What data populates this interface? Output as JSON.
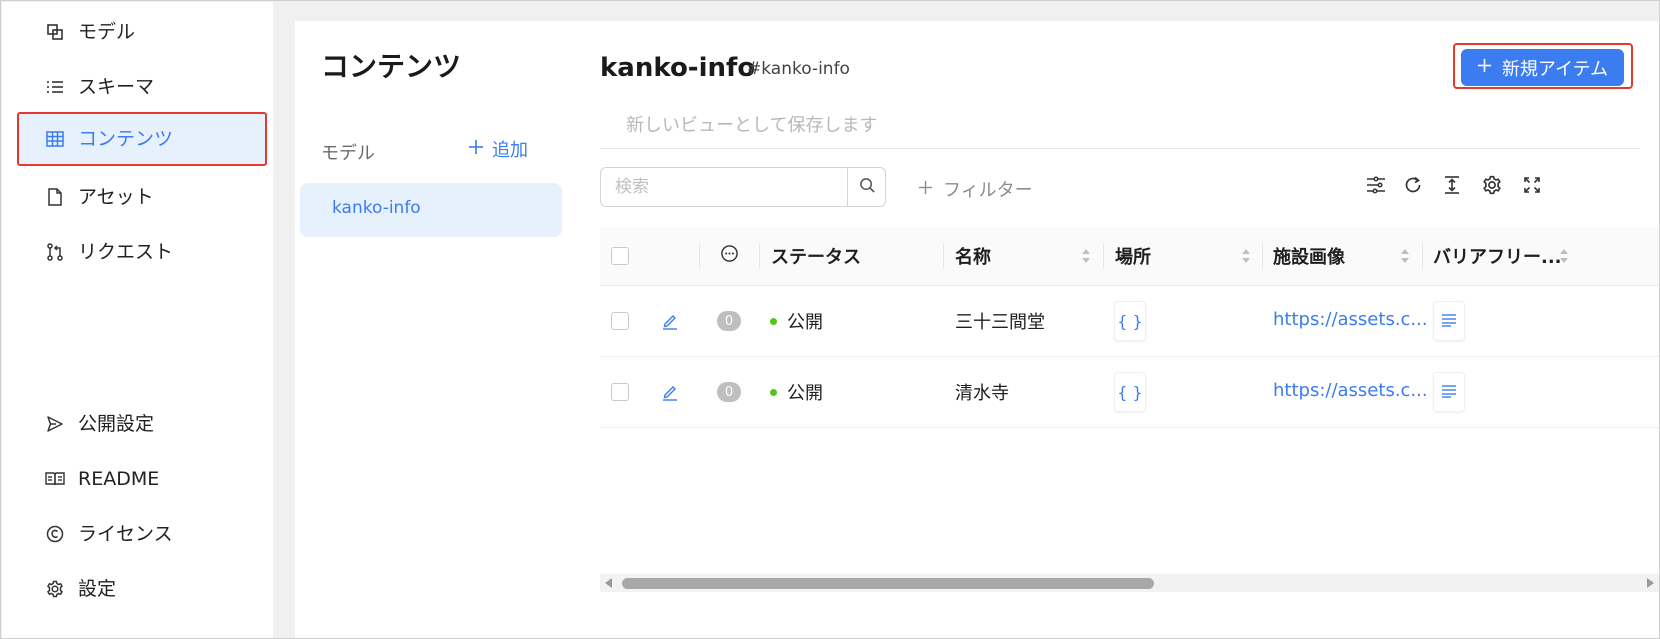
{
  "sidebar": {
    "items": [
      {
        "label": "モデル",
        "icon": "model-icon"
      },
      {
        "label": "スキーマ",
        "icon": "list-icon"
      },
      {
        "label": "コンテンツ",
        "icon": "table-icon",
        "active": true
      },
      {
        "label": "アセット",
        "icon": "file-icon"
      },
      {
        "label": "リクエスト",
        "icon": "pull-request-icon"
      }
    ],
    "bottom_items": [
      {
        "label": "公開設定",
        "icon": "send-icon"
      },
      {
        "label": "README",
        "icon": "book-icon"
      },
      {
        "label": "ライセンス",
        "icon": "copyright-icon"
      },
      {
        "label": "設定",
        "icon": "gear-icon"
      }
    ]
  },
  "models_panel": {
    "title": "コンテンツ",
    "subtitle": "モデル",
    "add_label": "追加",
    "items": [
      {
        "label": "kanko-info",
        "selected": true
      }
    ]
  },
  "main": {
    "title": "kanko-info",
    "key": "#kanko-info",
    "new_item_label": "新規アイテム",
    "view_placeholder": "新しいビューとして保存します",
    "search_placeholder": "検索",
    "filter_label": "フィルター",
    "columns": [
      "ステータス",
      "名称",
      "場所",
      "施設画像",
      "バリアフリー..."
    ],
    "rows": [
      {
        "comments": "0",
        "status": "公開",
        "name": "三十三間堂",
        "location": "{ }",
        "image": "https://assets.c..."
      },
      {
        "comments": "0",
        "status": "公開",
        "name": "清水寺",
        "location": "{ }",
        "image": "https://assets.c..."
      }
    ]
  },
  "colors": {
    "accent": "#3b7cf0",
    "highlight": "#e6392e",
    "status_published": "#52c41a",
    "selected_bg": "#e6f1fd"
  }
}
